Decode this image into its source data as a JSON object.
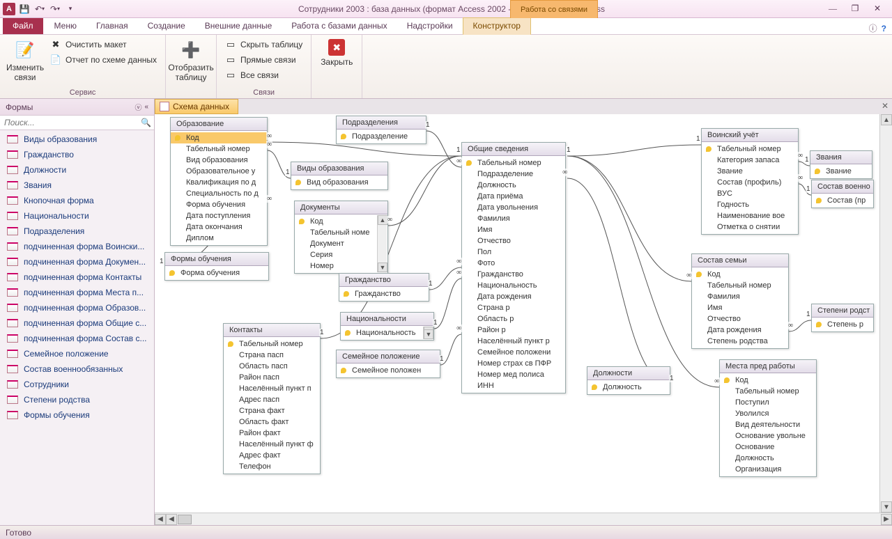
{
  "window": {
    "title": "Сотрудники 2003 : база данных (формат Access 2002 - 2003)  -  Microsoft Access",
    "context_tab_title": "Работа со связями"
  },
  "qat": {
    "save": "💾",
    "undo": "↶",
    "redo": "↷",
    "dd": "▾"
  },
  "winctl": {
    "min": "—",
    "max": "❐",
    "close": "✕"
  },
  "ribbon_tabs": {
    "file": "Файл",
    "menu": "Меню",
    "home": "Главная",
    "create": "Создание",
    "external": "Внешние данные",
    "dbtools": "Работа с базами данных",
    "addins": "Надстройки",
    "designer": "Конструктор"
  },
  "help": {
    "chev": "ⓘ",
    "q": "?"
  },
  "ribbon": {
    "g1_label": "Сервис",
    "edit_links": "Изменить связи",
    "clear_layout": "Очистить макет",
    "rel_report": "Отчет по схеме данных",
    "g2_label": "",
    "show_table": "Отобразить таблицу",
    "g3_label": "Связи",
    "hide_table": "Скрыть таблицу",
    "direct_rel": "Прямые связи",
    "all_rel": "Все связи",
    "g4_label": "",
    "close": "Закрыть"
  },
  "nav": {
    "header": "Формы",
    "search_ph": "Поиск...",
    "items": [
      "Виды образования",
      "Гражданство",
      "Должности",
      "Звания",
      "Кнопочная форма",
      "Национальности",
      "Подразделения",
      "подчиненная форма Воински...",
      "подчиненная форма Докумен...",
      "подчиненная форма Контакты",
      "подчиненная форма Места п...",
      "подчиненная форма Образов...",
      "подчиненная форма Общие с...",
      "подчиненная форма Состав с...",
      "Семейное положение",
      "Состав военнообязанных",
      "Сотрудники",
      "Степени родства",
      "Формы обучения"
    ]
  },
  "doc_tab": "Схема данных",
  "tables": {
    "obrazovanie": {
      "title": "Образование",
      "fields": [
        "Код",
        "Табельный номер",
        "Вид образования",
        "Образовательное у",
        "Квалификация по д",
        "Специальность по д",
        "Форма обучения",
        "Дата поступления",
        "Дата окончания",
        "Диплом"
      ],
      "pk": [
        0
      ]
    },
    "podrazd": {
      "title": "Подразделения",
      "fields": [
        "Подразделение"
      ],
      "pk": [
        0
      ]
    },
    "vidy_obr": {
      "title": "Виды образования",
      "fields": [
        "Вид образования"
      ],
      "pk": [
        0
      ]
    },
    "docs": {
      "title": "Документы",
      "fields": [
        "Код",
        "Табельный номе",
        "Документ",
        "Серия",
        "Номер"
      ],
      "pk": [
        0
      ]
    },
    "formy": {
      "title": "Формы обучения",
      "fields": [
        "Форма обучения"
      ],
      "pk": [
        0
      ]
    },
    "grazhd": {
      "title": "Гражданство",
      "fields": [
        "Гражданство"
      ],
      "pk": [
        0
      ]
    },
    "nation": {
      "title": "Национальности",
      "fields": [
        "Национальность"
      ],
      "pk": [
        0
      ]
    },
    "kontakty": {
      "title": "Контакты",
      "fields": [
        "Табельный номер",
        "Страна пасп",
        "Область пасп",
        "Район пасп",
        "Населённый пункт п",
        "Адрес пасп",
        "Страна факт",
        "Область факт",
        "Район факт",
        "Населённый пункт ф",
        "Адрес факт",
        "Телефон"
      ],
      "pk": [
        0
      ]
    },
    "semeinoe": {
      "title": "Семейное положение",
      "fields": [
        "Семейное положен"
      ],
      "pk": [
        0
      ]
    },
    "obshie": {
      "title": "Общие сведения",
      "fields": [
        "Табельный номер",
        "Подразделение",
        "Должность",
        "Дата приёма",
        "Дата увольнения",
        "Фамилия",
        "Имя",
        "Отчество",
        "Пол",
        "Фото",
        "Гражданство",
        "Национальность",
        "Дата рождения",
        "Страна р",
        "Область р",
        "Район р",
        "Населённый пункт р",
        "Семейное положени",
        "Номер страх св ПФР",
        "Номер мед полиса",
        "ИНН"
      ],
      "pk": [
        0
      ]
    },
    "dolzhn": {
      "title": "Должности",
      "fields": [
        "Должность"
      ],
      "pk": [
        0
      ]
    },
    "voinskiy": {
      "title": "Воинский учёт",
      "fields": [
        "Табельный номер",
        "Категория запаса",
        "Звание",
        "Состав (профиль)",
        "ВУС",
        "Годность",
        "Наименование вое",
        "Отметка о снятии"
      ],
      "pk": [
        0
      ]
    },
    "sostav_semi": {
      "title": "Состав семьи",
      "fields": [
        "Код",
        "Табельный номер",
        "Фамилия",
        "Имя",
        "Отчество",
        "Дата рождения",
        "Степень родства"
      ],
      "pk": [
        0
      ]
    },
    "mesta": {
      "title": "Места пред работы",
      "fields": [
        "Код",
        "Табельный номер",
        "Поступил",
        "Уволился",
        "Вид деятельности",
        "Основание увольне",
        "Основание",
        "Должность",
        "Организация"
      ],
      "pk": [
        0
      ]
    },
    "zvania": {
      "title": "Звания",
      "fields": [
        "Звание"
      ],
      "pk": [
        0
      ]
    },
    "sostav_voen": {
      "title": "Состав военно",
      "fields": [
        "Состав (пр"
      ],
      "pk": [
        0
      ]
    },
    "stepen": {
      "title": "Степени родст",
      "fields": [
        "Степень р"
      ],
      "pk": [
        0
      ]
    }
  },
  "status": "Готово"
}
